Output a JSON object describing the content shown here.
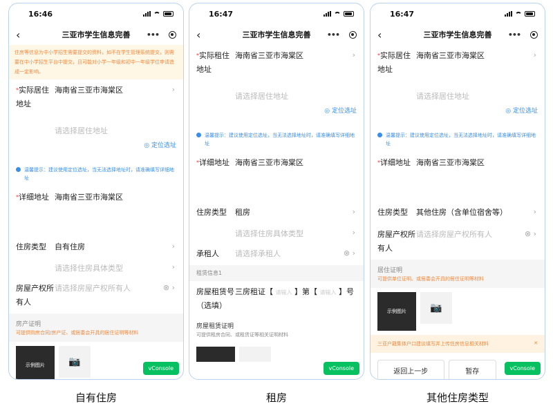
{
  "nav_title": "三亚市学生信息完善",
  "p1": {
    "time": "16:46",
    "warning": "住房等信息为中小学招生需要提交的资料，如不在学生管理系统提交，则需要在中小学招生平台中提交，且可能对小学一年级和初中一年级学位申请造成一定影响。",
    "residence_label": "实际居住地址",
    "residence_value": "海南省三亚市海棠区",
    "residence_placeholder": "请选择居住地址",
    "locate": "定位选址",
    "hint": "温馨提示：建议使用定位选址，当无法选择地址时，请准确填写详细地址",
    "detail_label": "详细地址",
    "detail_value": "海南省三亚市海棠区",
    "housing_label": "住房类型",
    "housing_value": "自有住房",
    "housing_sub_placeholder": "请选择住房具体类型",
    "owner_label": "房屋产权所有人",
    "owner_placeholder": "请选择房屋产权所有人",
    "cert_title": "房产证明",
    "cert_desc": "可提供购房合同/房产证、或居委会开具的居住证明等材料",
    "sample": "示例图片",
    "vconsole": "vConsole"
  },
  "p2": {
    "time": "16:47",
    "residence_label": "实际租住地址",
    "residence_value": "海南省三亚市海棠区",
    "residence_placeholder": "请选择居住地址",
    "locate": "定位选址",
    "hint": "温馨提示：建议使用定位选址，当无法选择地址时，请准确填写详细地址",
    "detail_label": "详细地址",
    "detail_value": "海南省三亚市海棠区",
    "housing_label": "住房类型",
    "housing_value": "租房",
    "housing_sub_placeholder": "请选择住房具体类型",
    "renter_label": "承租人",
    "renter_placeholder": "请选择承租人",
    "section": "租赁信息1",
    "cert_no_label": "房屋租赁号（选填）",
    "cert_prefix": "三房租证【",
    "cert_input": "请输入",
    "cert_mid": "】第【",
    "cert_suffix": "】号",
    "lease_title": "房屋租赁证明",
    "lease_desc": "可提供租房合同、或租赁证等相关证明材料",
    "vconsole": "vConsole"
  },
  "p3": {
    "time": "16:47",
    "residence_label": "实际居住地址",
    "residence_value": "海南省三亚市海棠区",
    "residence_placeholder": "请选择居住地址",
    "locate": "定位选址",
    "hint": "温馨提示：建议使用定位选址，当无法选择地址时，请准确填写详细地址",
    "detail_label": "详细地址",
    "detail_value": "海南省三亚市海棠区",
    "housing_label": "住房类型",
    "housing_value": "其他住房（含单位宿舍等）",
    "owner_label": "房屋产权所有人",
    "owner_placeholder": "请选择房屋产权所有人",
    "cert_title": "居住证明",
    "cert_desc": "可提供单位证明、或居委会开具的居住证明等材料",
    "sample": "示例图片",
    "notice": "三亚户籍集体户口建议填写并上传住房信息相关材料",
    "back_btn": "返回上一步",
    "save_btn": "暂存",
    "vconsole": "vConsole"
  },
  "captions": [
    "自有住房",
    "租房",
    "其他住房类型"
  ]
}
